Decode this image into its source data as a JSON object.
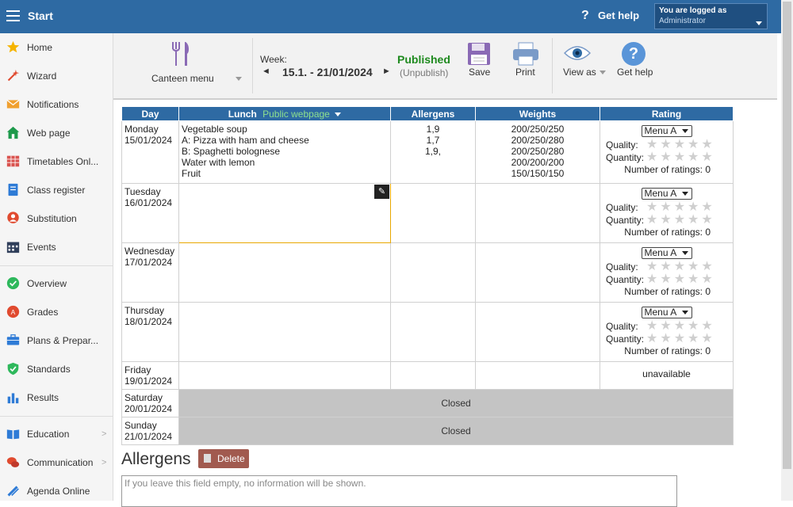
{
  "topbar": {
    "title": "Start",
    "help_label": "Get help",
    "help_glyph": "?",
    "logged_line1": "You are logged as",
    "logged_user": "Administrator"
  },
  "sidebar": {
    "items": [
      {
        "label": "Home",
        "icon": "star-icon",
        "color": "#f5b400"
      },
      {
        "label": "Wizard",
        "icon": "wand-icon",
        "color": "#e04a2f"
      },
      {
        "label": "Notifications",
        "icon": "envelope-icon",
        "color": "#f0a030"
      },
      {
        "label": "Web page",
        "icon": "house-icon",
        "color": "#1e9a4c"
      },
      {
        "label": "Timetables Onl...",
        "icon": "timetable-icon",
        "color": "#d9534f"
      },
      {
        "label": "Class register",
        "icon": "book-icon",
        "color": "#2e7bd6"
      },
      {
        "label": "Substitution",
        "icon": "person-icon",
        "color": "#e04a2f"
      },
      {
        "label": "Events",
        "icon": "calendar-icon",
        "color": "#2f3e5a"
      },
      {
        "label": "Overview",
        "icon": "check-circle-icon",
        "color": "#2eb85c"
      },
      {
        "label": "Grades",
        "icon": "grades-icon",
        "color": "#e04a2f"
      },
      {
        "label": "Plans & Prepar...",
        "icon": "plans-icon",
        "color": "#2e7bd6"
      },
      {
        "label": "Standards",
        "icon": "shield-check-icon",
        "color": "#2eb85c"
      },
      {
        "label": "Results",
        "icon": "bar-chart-icon",
        "color": "#2e7bd6"
      },
      {
        "label": "Education",
        "icon": "open-book-icon",
        "color": "#2e7bd6"
      },
      {
        "label": "Communication",
        "icon": "chat-icon",
        "color": "#e04a2f"
      },
      {
        "label": "Agenda Online",
        "icon": "pencil-icon",
        "color": "#2e7bd6"
      }
    ]
  },
  "toolbar": {
    "canteen_label": "Canteen menu",
    "week_label": "Week:",
    "week_range": "15.1. - 21/01/2024",
    "published": "Published",
    "unpublish": "(Unpublish)",
    "save": "Save",
    "print": "Print",
    "view_as": "View as",
    "get_help": "Get help",
    "prev_glyph": "◄",
    "next_glyph": "►",
    "help_glyph": "?"
  },
  "table": {
    "headers": {
      "day": "Day",
      "lunch": "Lunch",
      "lunch_link": "Public webpage",
      "allergens": "Allergens",
      "weights": "Weights",
      "rating": "Rating"
    },
    "quality_label": "Quality:",
    "quantity_label": "Quantity:",
    "ratings_label": "Number of ratings: 0",
    "menu_option": "Menu A",
    "rows": [
      {
        "day": "Monday",
        "date": "15/01/2024",
        "lunch": [
          "Vegetable soup",
          "A: Pizza with ham and cheese",
          "B: Spaghetti bolognese",
          "Water with lemon",
          "Fruit"
        ],
        "allergens": [
          "1,9",
          "1,7",
          "1,9,"
        ],
        "weights": [
          "200/250/250",
          "200/250/280",
          "200/250/280",
          "200/200/200",
          "150/150/150"
        ]
      },
      {
        "day": "Tuesday",
        "date": "16/01/2024"
      },
      {
        "day": "Wednesday",
        "date": "17/01/2024"
      },
      {
        "day": "Thursday",
        "date": "18/01/2024"
      },
      {
        "day": "Friday",
        "date": "19/01/2024",
        "rating_text": "unavailable"
      },
      {
        "day": "Saturday",
        "date": "20/01/2024",
        "closed": "Closed"
      },
      {
        "day": "Sunday",
        "date": "21/01/2024",
        "closed": "Closed"
      }
    ]
  },
  "allergens_section": {
    "title": "Allergens",
    "delete_label": "Delete",
    "placeholder": "If you leave this field empty, no information will be shown."
  },
  "colors": {
    "header_blue": "#2e6aa3",
    "published_green": "#1e8a1e",
    "link_green": "#8ee08e",
    "closed_gray": "#c4c4c4",
    "delete_red": "#a15a4f"
  }
}
